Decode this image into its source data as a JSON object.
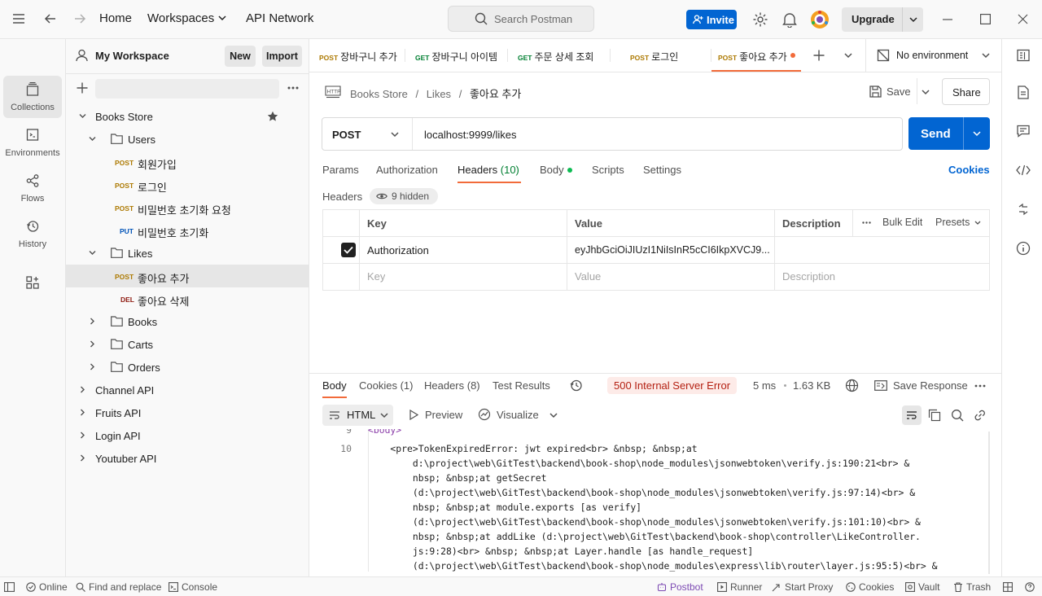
{
  "topbar": {
    "home": "Home",
    "workspaces": "Workspaces",
    "api_network": "API Network",
    "search_placeholder": "Search Postman",
    "invite": "Invite",
    "upgrade": "Upgrade"
  },
  "rail": {
    "collections": "Collections",
    "environments": "Environments",
    "flows": "Flows",
    "history": "History"
  },
  "sidebar": {
    "workspace": "My Workspace",
    "new": "New",
    "import": "Import",
    "tree": {
      "books_store": "Books Store",
      "users": "Users",
      "signup": "회원가입",
      "login": "로그인",
      "pw_reset_request": "비밀번호 초기화 요청",
      "pw_reset": "비밀번호 초기화",
      "likes": "Likes",
      "like_add": "좋아요 추가",
      "like_delete": "좋아요 삭제",
      "books": "Books",
      "carts": "Carts",
      "orders": "Orders",
      "channel_api": "Channel API",
      "fruits_api": "Fruits API",
      "login_api": "Login API",
      "youtuber_api": "Youtuber API"
    },
    "methods": {
      "post": "POST",
      "get": "GET",
      "put": "PUT",
      "del": "DEL"
    }
  },
  "tabs": [
    {
      "method": "POST",
      "title": "장바구니 추가"
    },
    {
      "method": "GET",
      "title": "장바구니 아이템"
    },
    {
      "method": "GET",
      "title": "주문 상세 조회"
    },
    {
      "method": "POST",
      "title": "로그인"
    },
    {
      "method": "POST",
      "title": "좋아요 추가"
    }
  ],
  "environment": "No environment",
  "request": {
    "breadcrumb": [
      "Books Store",
      "Likes",
      "좋아요 추가"
    ],
    "save": "Save",
    "share": "Share",
    "method": "POST",
    "url": "localhost:9999/likes",
    "send": "Send",
    "tabs": {
      "params": "Params",
      "authorization": "Authorization",
      "headers": "Headers",
      "headers_count": "(10)",
      "body": "Body",
      "scripts": "Scripts",
      "settings": "Settings"
    },
    "cookies": "Cookies",
    "headers_label": "Headers",
    "hidden": "9 hidden",
    "table": {
      "col_key": "Key",
      "col_value": "Value",
      "col_description": "Description",
      "bulk_edit": "Bulk Edit",
      "presets": "Presets",
      "row_key": "Authorization",
      "row_value": "eyJhbGciOiJIUzI1NiIsInR5cCI6IkpXVCJ9....",
      "ph_key": "Key",
      "ph_value": "Value",
      "ph_description": "Description"
    }
  },
  "response": {
    "tabs": {
      "body": "Body",
      "cookies": "Cookies (1)",
      "headers": "Headers (8)",
      "test_results": "Test Results"
    },
    "status": "500 Internal Server Error",
    "time": "5 ms",
    "size": "1.63 KB",
    "save_response": "Save Response",
    "format": "HTML",
    "preview": "Preview",
    "visualize": "Visualize",
    "line_numbers": [
      "9",
      "10"
    ],
    "code_lines": [
      "<body>",
      "    <pre>TokenExpiredError: jwt expired<br> &nbsp; &nbsp;at",
      "        d:\\project\\web\\GitTest\\backend\\book-shop\\node_modules\\jsonwebtoken\\verify.js:190:21<br> &",
      "        nbsp; &nbsp;at getSecret",
      "        (d:\\project\\web\\GitTest\\backend\\book-shop\\node_modules\\jsonwebtoken\\verify.js:97:14)<br> &",
      "        nbsp; &nbsp;at module.exports [as verify]",
      "        (d:\\project\\web\\GitTest\\backend\\book-shop\\node_modules\\jsonwebtoken\\verify.js:101:10)<br> &",
      "        nbsp; &nbsp;at addLike (d:\\project\\web\\GitTest\\backend\\book-shop\\controller\\LikeController.",
      "        js:9:28)<br> &nbsp; &nbsp;at Layer.handle [as handle_request]",
      "        (d:\\project\\web\\GitTest\\backend\\book-shop\\node_modules\\express\\lib\\router\\layer.js:95:5)<br> &"
    ]
  },
  "statusbar": {
    "online": "Online",
    "find_replace": "Find and replace",
    "console": "Console",
    "postbot": "Postbot",
    "runner": "Runner",
    "start_proxy": "Start Proxy",
    "cookies": "Cookies",
    "vault": "Vault",
    "trash": "Trash"
  },
  "colors": {
    "accent": "#f26b3a",
    "primary": "#0265d2",
    "error": "#b42012",
    "post": "#ad7a03",
    "get": "#007f31",
    "put": "#0053b8",
    "del": "#8e1a10"
  }
}
